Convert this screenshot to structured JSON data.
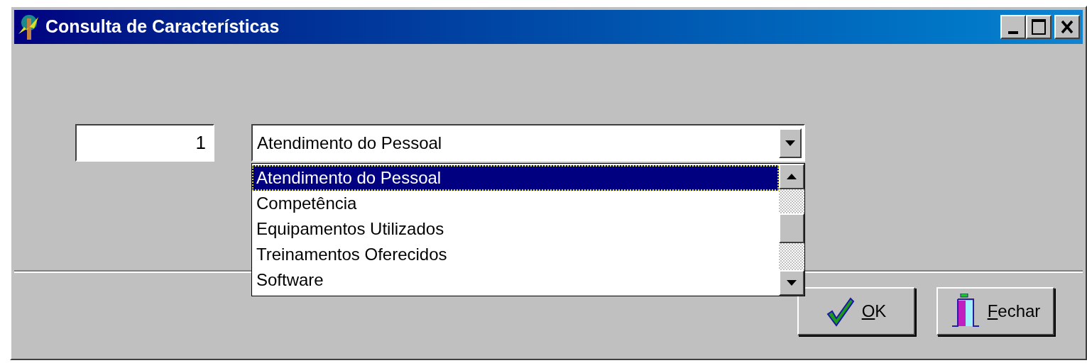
{
  "window": {
    "title": "Consulta de Características"
  },
  "code_field": {
    "value": "1"
  },
  "combo": {
    "value": "Atendimento do Pessoal",
    "expanded": true,
    "options": [
      {
        "label": "Atendimento do Pessoal",
        "selected": true
      },
      {
        "label": "Competência",
        "selected": false
      },
      {
        "label": "Equipamentos Utilizados",
        "selected": false
      },
      {
        "label": "Treinamentos Oferecidos",
        "selected": false
      },
      {
        "label": "Software",
        "selected": false
      }
    ]
  },
  "buttons": [
    {
      "label": "OK",
      "kind": "ok"
    },
    {
      "label": "Fechar",
      "kind": "close"
    }
  ]
}
